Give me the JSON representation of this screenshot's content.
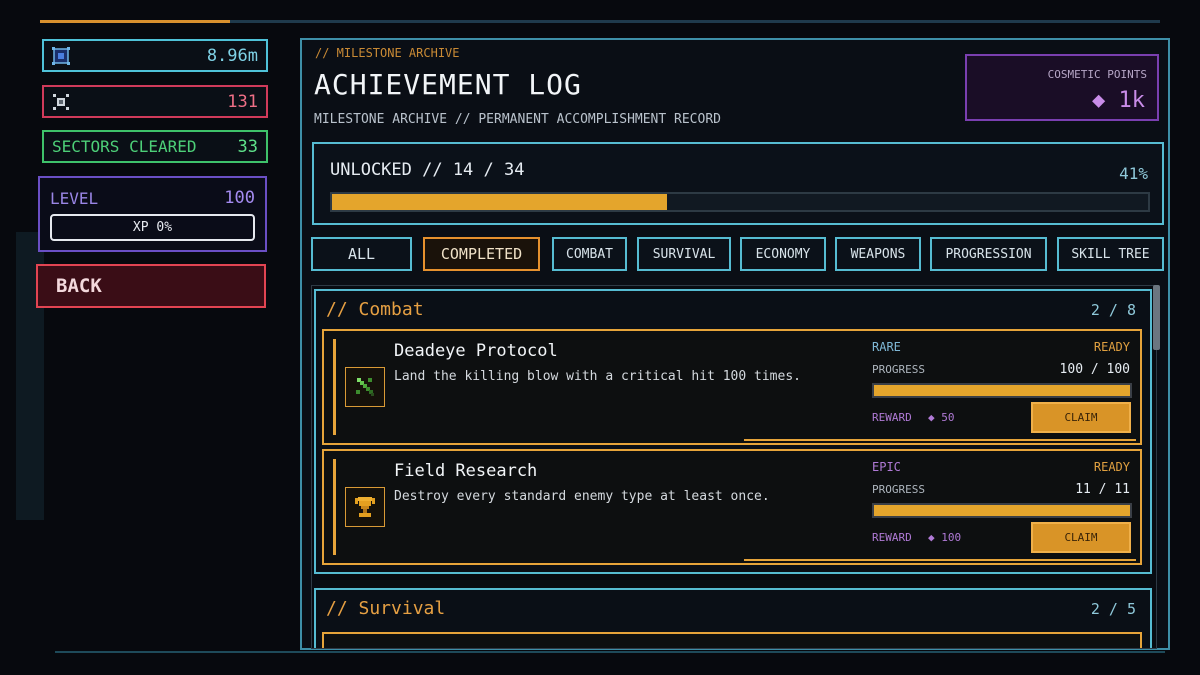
{
  "hud": {
    "credits": "8.96m",
    "kills": "131",
    "sectors_label": "SECTORS CLEARED",
    "sectors_value": "33",
    "level_label": "LEVEL",
    "level_value": "100",
    "xp_label": "XP 0%",
    "back_label": "BACK"
  },
  "header": {
    "eyebrow": "// MILESTONE ARCHIVE",
    "title": "ACHIEVEMENT LOG",
    "subtitle": "MILESTONE ARCHIVE // PERMANENT ACCOMPLISHMENT RECORD",
    "cosmetic_label": "COSMETIC POINTS",
    "cosmetic_value": "◆ 1k"
  },
  "unlock": {
    "label": "UNLOCKED // 14 / 34",
    "percent_text": "41%",
    "fraction": 0.41
  },
  "tabs": [
    {
      "label": "ALL",
      "active": false
    },
    {
      "label": "COMPLETED",
      "active": true
    },
    {
      "label": "COMBAT",
      "active": false
    },
    {
      "label": "SURVIVAL",
      "active": false
    },
    {
      "label": "ECONOMY",
      "active": false
    },
    {
      "label": "WEAPONS",
      "active": false
    },
    {
      "label": "PROGRESSION",
      "active": false
    },
    {
      "label": "SKILL TREE",
      "active": false
    }
  ],
  "sections": [
    {
      "title": "// Combat",
      "count": "2 / 8",
      "achievements": [
        {
          "name": "Deadeye Protocol",
          "description": "Land the killing blow with a critical hit 100 times.",
          "rarity": "RARE",
          "rarity_color": "#7fb8d6",
          "state": "READY",
          "progress_label": "PROGRESS",
          "progress_text": "100 / 100",
          "progress_fraction": 1.0,
          "reward_label": "REWARD",
          "reward_value": "◆ 50",
          "claim_label": "CLAIM",
          "icon": "sword-icon"
        },
        {
          "name": "Field Research",
          "description": "Destroy every standard enemy type at least once.",
          "rarity": "EPIC",
          "rarity_color": "#b07ad6",
          "state": "READY",
          "progress_label": "PROGRESS",
          "progress_text": "11 / 11",
          "progress_fraction": 1.0,
          "reward_label": "REWARD",
          "reward_value": "◆ 100",
          "claim_label": "CLAIM",
          "icon": "trophy-icon"
        }
      ]
    },
    {
      "title": "// Survival",
      "count": "2 / 5"
    }
  ],
  "colors": {
    "accent_orange": "#e4a52c",
    "accent_cyan": "#56bcd2",
    "accent_purple": "#b07ad6"
  }
}
